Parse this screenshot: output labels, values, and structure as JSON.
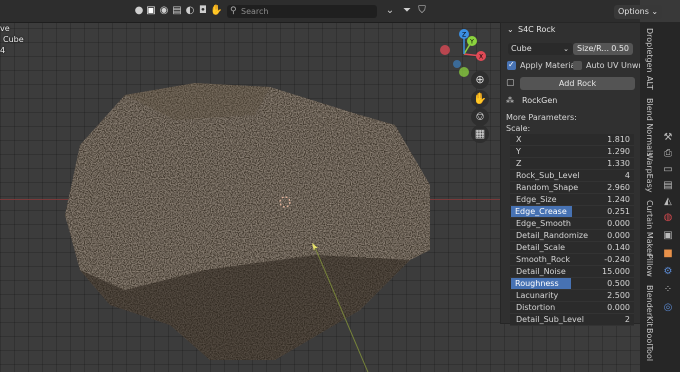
{
  "header": {
    "search_placeholder": "Search",
    "options_label": "Options"
  },
  "overlay": {
    "line1": "ve",
    "line2": "Cube",
    "line3": "4"
  },
  "gizmo": {
    "x": "X",
    "y": "Y",
    "z": "Z"
  },
  "panel": {
    "title": "S4C Rock",
    "shape_select": "Cube",
    "size_label": "Size/R...",
    "size_value": "0.50",
    "apply_material": "Apply Material",
    "apply_material_checked": true,
    "auto_uv": "Auto UV Unwrap",
    "auto_uv_checked": false,
    "add_rock": "Add Rock",
    "rockgen": "RockGen",
    "more_params": "More Parameters:",
    "scale_label": "Scale:",
    "params": [
      {
        "name": "X",
        "value": "1.810"
      },
      {
        "name": "Y",
        "value": "1.290"
      },
      {
        "name": "Z",
        "value": "1.330"
      },
      {
        "name": "Rock_Sub_Level",
        "value": "4"
      },
      {
        "name": "Random_Shape",
        "value": "2.960"
      },
      {
        "name": "Edge_Size",
        "value": "1.240"
      },
      {
        "name": "Edge_Crease",
        "value": "0.251"
      },
      {
        "name": "Edge_Smooth",
        "value": "0.000"
      },
      {
        "name": "Detail_Randomize",
        "value": "0.000"
      },
      {
        "name": "Detail_Scale",
        "value": "0.140"
      },
      {
        "name": "Smooth_Rock",
        "value": "-0.240"
      },
      {
        "name": "Detail_Noise",
        "value": "15.000"
      },
      {
        "name": "Roughness",
        "value": "0.500"
      },
      {
        "name": "Lacunarity",
        "value": "2.500"
      },
      {
        "name": "Distortion",
        "value": "0.000"
      },
      {
        "name": "Detail_Sub_Level",
        "value": "2"
      }
    ]
  },
  "tabs": {
    "dropletgen": "Dropletgen",
    "alt": "ALT",
    "blend_normals": "Blend Normals",
    "warpeasy": "WarpEasy",
    "curtain_maker": "Curtain Maker",
    "pillow": "Pillow",
    "blenderkit": "BlenderKit",
    "bool_tool": "BoolTool"
  },
  "colors": {
    "accent": "#4772b3",
    "x_axis": "#e14a56",
    "y_axis": "#8bd33e",
    "z_axis": "#3b8fe2"
  }
}
